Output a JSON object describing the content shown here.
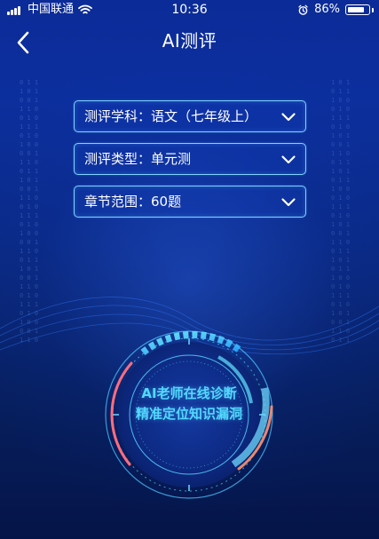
{
  "status_bar": {
    "carrier": "中国联通",
    "time": "10:36",
    "battery": "86%"
  },
  "header": {
    "title": "AI测评"
  },
  "fields": [
    {
      "label": "测评学科：语文（七年级上）"
    },
    {
      "label": "测评类型：单元测"
    },
    {
      "label": "章节范围：60题"
    }
  ],
  "circle": {
    "line1": "AI老师在线诊断",
    "line2": "精准定位知识漏洞"
  },
  "icons": {
    "back": "back-icon",
    "chevron": "chevron-down-icon",
    "wifi": "wifi-icon",
    "alarm": "alarm-icon",
    "battery": "battery-icon"
  },
  "colors": {
    "accent": "#52d8ff",
    "border": "#7fd4ff",
    "background_top": "#0b2b98",
    "background_bottom": "#051448"
  }
}
